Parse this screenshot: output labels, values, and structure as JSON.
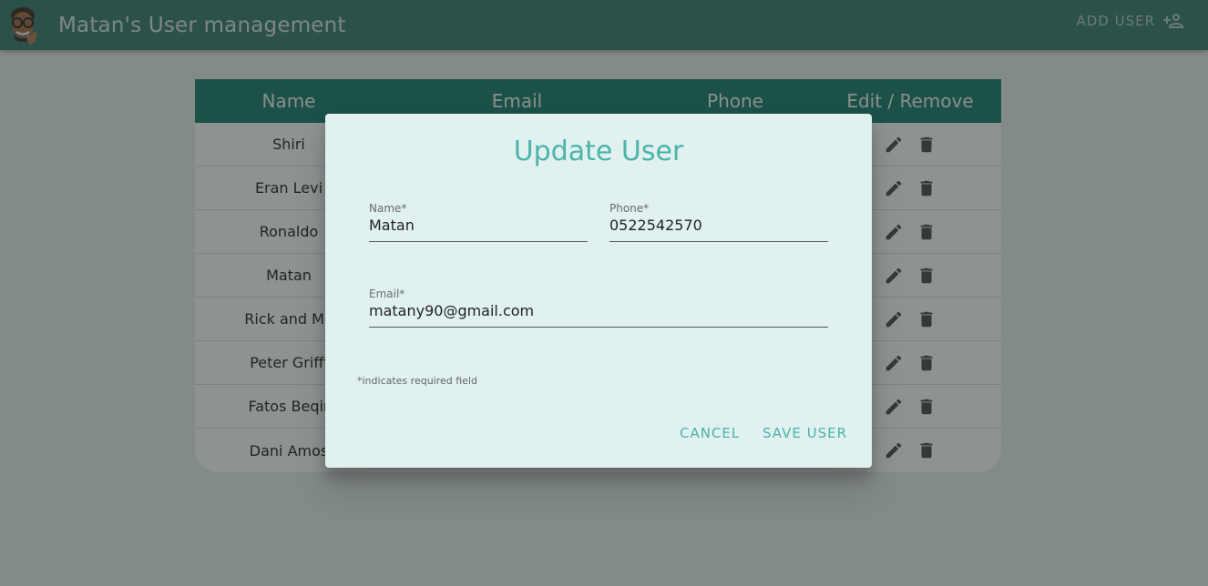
{
  "header": {
    "title": "Matan's User management",
    "add_user_label": "ADD USER"
  },
  "table": {
    "columns": [
      "Name",
      "Email",
      "Phone",
      "Edit / Remove"
    ],
    "rows": [
      {
        "name": "Shiri"
      },
      {
        "name": "Eran Levi"
      },
      {
        "name": "Ronaldo"
      },
      {
        "name": "Matan"
      },
      {
        "name": "Rick and Mo"
      },
      {
        "name": "Peter Griffi"
      },
      {
        "name": "Fatos Beqir"
      },
      {
        "name": "Dani Amos"
      }
    ]
  },
  "dialog": {
    "title": "Update User",
    "name_label": "Name*",
    "name_value": "Matan",
    "phone_label": "Phone*",
    "phone_value": "0522542570",
    "email_label": "Email*",
    "email_value": "matany90@gmail.com",
    "required_note": "*indicates required field",
    "cancel_label": "CANCEL",
    "save_label": "SAVE USER"
  },
  "colors": {
    "appbar": "#3a7a70",
    "table_header": "#1a7a6a",
    "accent": "#4db3a8",
    "dialog_bg": "#e0f1f0"
  },
  "icons": {
    "avatar": "memoji-avatar",
    "add_user": "person-add-icon",
    "edit": "pencil-icon",
    "remove": "trash-icon"
  }
}
